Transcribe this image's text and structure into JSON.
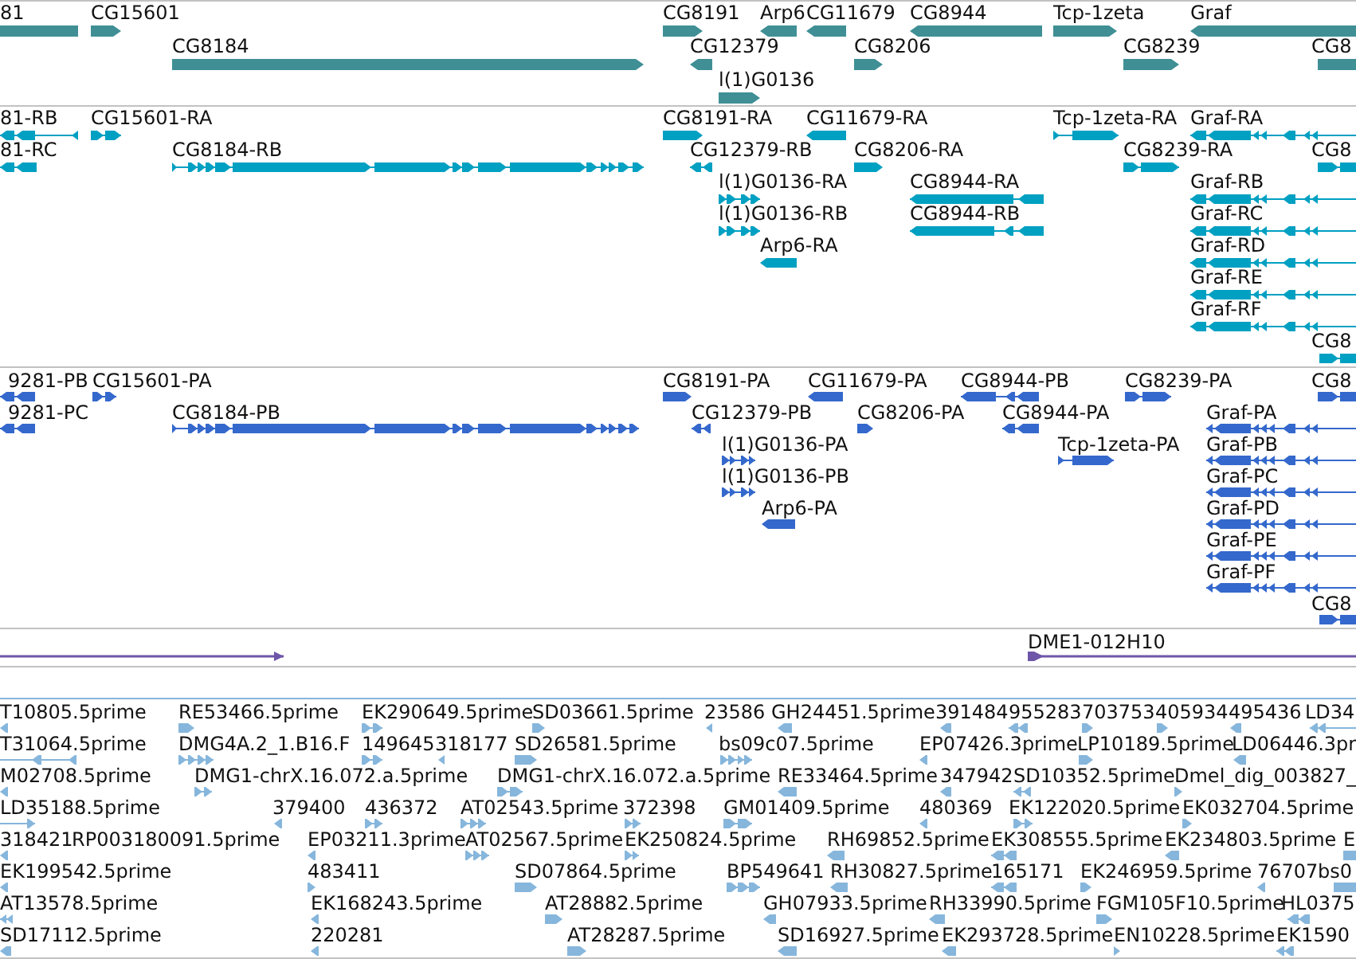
{
  "tracks": [
    {
      "kind": "gene",
      "color": "#3f8f95",
      "features": [
        {
          "label": "81"
        },
        {
          "label": "CG15601",
          "reverse": false
        },
        {
          "label": "CG8191",
          "reverse": false
        },
        {
          "label": "Arp6",
          "reverse": true
        },
        {
          "label": "CG11679",
          "reverse": true
        },
        {
          "label": "CG8944",
          "reverse": true
        },
        {
          "label": "Tcp-1zeta",
          "reverse": false
        },
        {
          "label": "Graf",
          "reverse": true
        },
        {
          "label": "CG8184",
          "reverse": false
        },
        {
          "label": "CG12379",
          "reverse": true
        },
        {
          "label": "CG8206",
          "reverse": false
        },
        {
          "label": "CG8239",
          "reverse": false
        },
        {
          "label": "CG8"
        },
        {
          "label": "l(1)G0136",
          "reverse": false
        }
      ]
    },
    {
      "kind": "transcript",
      "color": "#00a0c2",
      "features": [
        {
          "label": "81-RB",
          "reverse": true
        },
        {
          "label": "CG15601-RA",
          "reverse": false
        },
        {
          "label": "CG8191-RA",
          "reverse": false
        },
        {
          "label": "CG11679-RA",
          "reverse": true
        },
        {
          "label": "Tcp-1zeta-RA",
          "reverse": false
        },
        {
          "label": "Graf-RA",
          "reverse": true
        },
        {
          "label": "81-RC",
          "reverse": true
        },
        {
          "label": "CG8184-RB",
          "reverse": false
        },
        {
          "label": "CG12379-RB",
          "reverse": true
        },
        {
          "label": "CG8206-RA",
          "reverse": false
        },
        {
          "label": "CG8239-RA",
          "reverse": false
        },
        {
          "label": "CG8",
          "reverse": false
        },
        {
          "label": "l(1)G0136-RA",
          "reverse": false
        },
        {
          "label": "CG8944-RA",
          "reverse": true
        },
        {
          "label": "Graf-RB",
          "reverse": true
        },
        {
          "label": "l(1)G0136-RB",
          "reverse": false
        },
        {
          "label": "CG8944-RB",
          "reverse": true
        },
        {
          "label": "Graf-RC",
          "reverse": true
        },
        {
          "label": "Arp6-RA",
          "reverse": true
        },
        {
          "label": "Graf-RD",
          "reverse": true
        },
        {
          "label": "Graf-RE",
          "reverse": true
        },
        {
          "label": "Graf-RF",
          "reverse": true
        },
        {
          "label": "CG8",
          "reverse": false
        }
      ]
    },
    {
      "kind": "protein",
      "color": "#3468cc",
      "features": [
        {
          "label": "9281-PB",
          "reverse": true
        },
        {
          "label": "CG15601-PA",
          "reverse": false
        },
        {
          "label": "CG8191-PA",
          "reverse": false
        },
        {
          "label": "CG11679-PA",
          "reverse": true
        },
        {
          "label": "CG8944-PB",
          "reverse": true
        },
        {
          "label": "CG8239-PA",
          "reverse": false
        },
        {
          "label": "CG8",
          "reverse": false
        },
        {
          "label": "9281-PC",
          "reverse": true
        },
        {
          "label": "CG8184-PB",
          "reverse": false
        },
        {
          "label": "CG12379-PB",
          "reverse": true
        },
        {
          "label": "CG8206-PA",
          "reverse": false
        },
        {
          "label": "CG8944-PA",
          "reverse": true
        },
        {
          "label": "Graf-PA",
          "reverse": true
        },
        {
          "label": "l(1)G0136-PA",
          "reverse": false
        },
        {
          "label": "Tcp-1zeta-PA",
          "reverse": false
        },
        {
          "label": "Graf-PB",
          "reverse": true
        },
        {
          "label": "l(1)G0136-PB",
          "reverse": false
        },
        {
          "label": "Graf-PC",
          "reverse": true
        },
        {
          "label": "Arp6-PA",
          "reverse": true
        },
        {
          "label": "Graf-PD",
          "reverse": true
        },
        {
          "label": "Graf-PE",
          "reverse": true
        },
        {
          "label": "Graf-PF",
          "reverse": true
        },
        {
          "label": "CG8",
          "reverse": false
        }
      ]
    },
    {
      "kind": "clone",
      "color": "#6e56a8",
      "features": [
        {
          "reverse": false
        },
        {
          "label": "DME1-012H10",
          "reverse": false
        }
      ]
    },
    {
      "kind": "est",
      "color": "#86b6dc",
      "features": [
        {
          "label": "T10805.5prime",
          "reverse": true
        },
        {
          "label": "RE53466.5prime",
          "reverse": false
        },
        {
          "label": "EK290649.5prime",
          "reverse": false
        },
        {
          "label": "SD03661.5prime",
          "reverse": false
        },
        {
          "label": "23586",
          "reverse": true
        },
        {
          "label": "GH24451.5prime",
          "reverse": true
        },
        {
          "label": "391484",
          "reverse": true
        },
        {
          "label": "955283",
          "reverse": true
        },
        {
          "label": "703753",
          "reverse": false
        },
        {
          "label": "405934",
          "reverse": false
        },
        {
          "label": "495436",
          "reverse": true
        },
        {
          "label": "LD34",
          "reverse": true
        },
        {
          "label": "T31064.5prime",
          "reverse": true
        },
        {
          "label": "DMG4A.2_1.B16.F",
          "reverse": false
        },
        {
          "label": "149645",
          "reverse": false
        },
        {
          "label": "318177",
          "reverse": true
        },
        {
          "label": "SD26581.5prime",
          "reverse": false
        },
        {
          "label": "bs09c07.5prime",
          "reverse": false
        },
        {
          "label": "EP07426.3prime",
          "reverse": true
        },
        {
          "label": "LP10189.5prime",
          "reverse": false
        },
        {
          "label": "LD06446.3pr",
          "reverse": true
        },
        {
          "label": "M02708.5prime",
          "reverse": true
        },
        {
          "label": "DMG1-chrX.16.072.a.5prime",
          "reverse": false
        },
        {
          "label": "DMG1-chrX.16.072.a.5prime",
          "reverse": false
        },
        {
          "label": "RE33464.5prime",
          "reverse": true
        },
        {
          "label": "347942",
          "reverse": true
        },
        {
          "label": "SD10352.5prime",
          "reverse": true
        },
        {
          "label": "Dmel_dig_003827_",
          "reverse": false
        },
        {
          "label": "LD35188.5prime",
          "reverse": false
        },
        {
          "label": "379400",
          "reverse": true
        },
        {
          "label": "436372",
          "reverse": false
        },
        {
          "label": "AT02543.5prime",
          "reverse": false
        },
        {
          "label": "372398",
          "reverse": false
        },
        {
          "label": "GM01409.5prime",
          "reverse": false
        },
        {
          "label": "480369",
          "reverse": true
        },
        {
          "label": "EK122020.5prime",
          "reverse": false
        },
        {
          "label": "EK032704.5prime",
          "reverse": false
        },
        {
          "label": "318421",
          "reverse": true
        },
        {
          "label": "RP003180091.5prime"
        },
        {
          "label": "EP03211.3prime",
          "reverse": true
        },
        {
          "label": "AT02567.5prime",
          "reverse": false
        },
        {
          "label": "EK250824.5prime",
          "reverse": false
        },
        {
          "label": "RH69852.5prime",
          "reverse": true
        },
        {
          "label": "EK308555.5prime",
          "reverse": true
        },
        {
          "label": "EK234803.5prime",
          "reverse": true
        },
        {
          "label": "E",
          "reverse": false
        },
        {
          "label": "EK199542.5prime",
          "reverse": true
        },
        {
          "label": "483411",
          "reverse": false
        },
        {
          "label": "SD07864.5prime",
          "reverse": false
        },
        {
          "label": "BP549641",
          "reverse": false
        },
        {
          "label": "RH30827.5prime",
          "reverse": true
        },
        {
          "label": "165171",
          "reverse": true
        },
        {
          "label": "EK246959.5prime",
          "reverse": false
        },
        {
          "label": "76707",
          "reverse": true
        },
        {
          "label": "bs0",
          "reverse": false
        },
        {
          "label": "AT13578.5prime",
          "reverse": true
        },
        {
          "label": "EK168243.5prime",
          "reverse": true
        },
        {
          "label": "AT28882.5prime",
          "reverse": false
        },
        {
          "label": "GH07933.5prime",
          "reverse": true
        },
        {
          "label": "RH33990.5prime",
          "reverse": true
        },
        {
          "label": "FGM105F10.5prime",
          "reverse": false
        },
        {
          "label": "HL0375",
          "reverse": true
        },
        {
          "label": "SD17112.5prime",
          "reverse": true
        },
        {
          "label": "220281",
          "reverse": true
        },
        {
          "label": "AT28287.5prime",
          "reverse": false
        },
        {
          "label": "SD16927.5prime",
          "reverse": true
        },
        {
          "label": "EK293728.5prime",
          "reverse": true
        },
        {
          "label": "EN10228.5prime",
          "reverse": false
        },
        {
          "label": "EK1590",
          "reverse": true
        }
      ]
    }
  ]
}
